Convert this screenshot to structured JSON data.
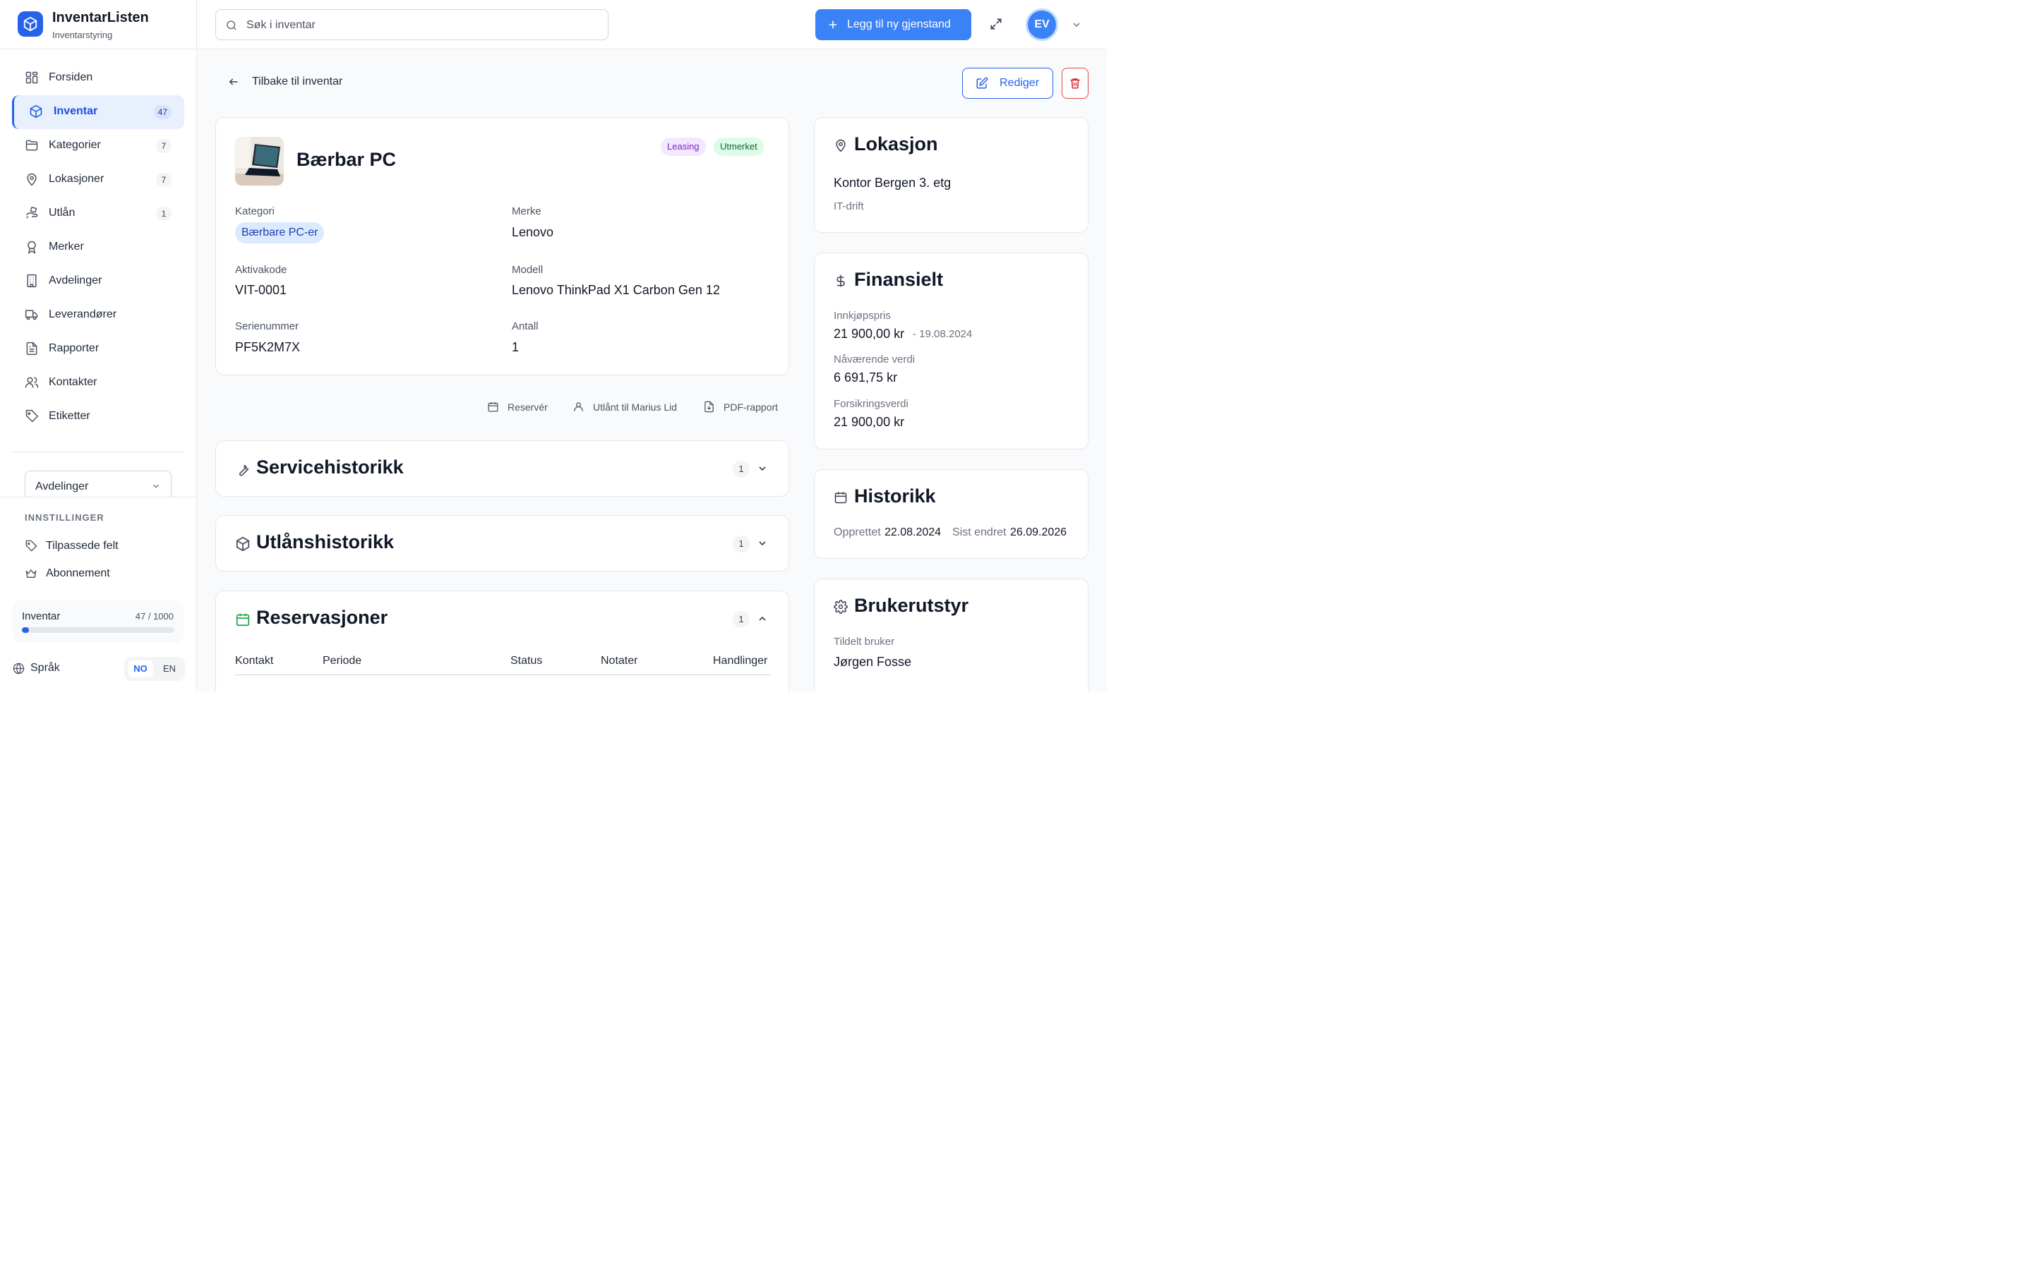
{
  "app": {
    "name": "InventarListen",
    "subtitle": "Inventarstyring"
  },
  "sidebar": {
    "items": [
      {
        "label": "Forsiden",
        "icon": "grid-icon"
      },
      {
        "label": "Inventar",
        "icon": "box-icon",
        "count": "47",
        "active": true
      },
      {
        "label": "Kategorier",
        "icon": "folder-icon",
        "count": "7"
      },
      {
        "label": "Lokasjoner",
        "icon": "map-pin-icon",
        "count": "7"
      },
      {
        "label": "Utlån",
        "icon": "hand-loan-icon",
        "count": "1"
      },
      {
        "label": "Merker",
        "icon": "award-icon"
      },
      {
        "label": "Avdelinger",
        "icon": "building-icon"
      },
      {
        "label": "Leverandører",
        "icon": "truck-icon"
      },
      {
        "label": "Rapporter",
        "icon": "file-text-icon"
      },
      {
        "label": "Kontakter",
        "icon": "users-icon"
      },
      {
        "label": "Etiketter",
        "icon": "tag-icon"
      }
    ],
    "department_select": "Avdelinger",
    "settings_title": "INNSTILLINGER",
    "settings_items": [
      {
        "label": "Tilpassede felt",
        "icon": "tag-icon"
      },
      {
        "label": "Abonnement",
        "icon": "crown-icon"
      }
    ],
    "usage": {
      "label": "Inventar",
      "value": "47 / 1000",
      "fraction": 0.047
    },
    "language": {
      "label": "Språk",
      "options": [
        "NO",
        "EN"
      ],
      "selected": "NO"
    }
  },
  "topbar": {
    "search_placeholder": "Søk i inventar",
    "add_button": "Legg til ny gjenstand",
    "avatar_initials": "EV"
  },
  "page": {
    "back_label": "Tilbake til inventar",
    "edit_label": "Rediger"
  },
  "item": {
    "title": "Bærbar PC",
    "badges": [
      "Leasing",
      "Utmerket"
    ],
    "fields": {
      "category_label": "Kategori",
      "category_value": "Bærbare PC-er",
      "brand_label": "Merke",
      "brand_value": "Lenovo",
      "asset_label": "Aktivakode",
      "asset_value": "VIT-0001",
      "model_label": "Modell",
      "model_value": "Lenovo ThinkPad X1 Carbon Gen 12",
      "serial_label": "Serienummer",
      "serial_value": "PF5K2M7X",
      "qty_label": "Antall",
      "qty_value": "1"
    }
  },
  "actions": {
    "reserve": "Reservér",
    "loaned": "Utlånt til Marius Lid",
    "pdf": "PDF-rapport"
  },
  "sections": {
    "service": {
      "title": "Servicehistorikk",
      "count": "1"
    },
    "loans": {
      "title": "Utlånshistorikk",
      "count": "1"
    },
    "reservations": {
      "title": "Reservasjoner",
      "count": "1",
      "columns": [
        "Kontakt",
        "Periode",
        "Status",
        "Notater",
        "Handlinger"
      ]
    }
  },
  "location": {
    "title": "Lokasjon",
    "place": "Kontor Bergen 3. etg",
    "department": "IT-drift"
  },
  "financial": {
    "title": "Finansielt",
    "purchase_label": "Innkjøpspris",
    "purchase_value": "21 900,00 kr",
    "purchase_date": "- 19.08.2024",
    "current_label": "Nåværende verdi",
    "current_value": "6 691,75 kr",
    "insurance_label": "Forsikringsverdi",
    "insurance_value": "21 900,00 kr"
  },
  "history": {
    "title": "Historikk",
    "created_label": "Opprettet",
    "created_value": "22.08.2024",
    "modified_label": "Sist endret",
    "modified_value": "26.09.2026"
  },
  "user_equipment": {
    "title": "Brukerutstyr",
    "assigned_label": "Tildelt bruker",
    "assigned_value": "Jørgen Fosse"
  },
  "colors": {
    "accent": "#2563eb",
    "leasing": "#7e22ce",
    "condition": "#166534",
    "danger": "#dc2626"
  }
}
